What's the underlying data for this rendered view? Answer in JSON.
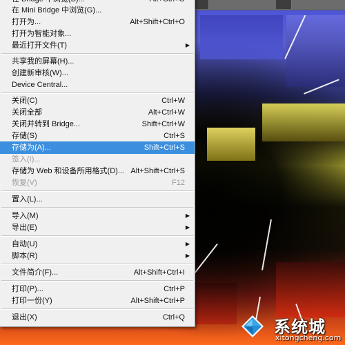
{
  "menu": {
    "items": [
      {
        "label": "在 Bridge 中浏览(B)...",
        "shortcut": "Alt+Ctrl+O",
        "arrow": "",
        "state": "normal"
      },
      {
        "label": "在 Mini Bridge 中浏览(G)...",
        "shortcut": "",
        "arrow": "",
        "state": "normal"
      },
      {
        "label": "打开为...",
        "shortcut": "Alt+Shift+Ctrl+O",
        "arrow": "",
        "state": "normal"
      },
      {
        "label": "打开为智能对象...",
        "shortcut": "",
        "arrow": "",
        "state": "normal"
      },
      {
        "label": "最近打开文件(T)",
        "shortcut": "",
        "arrow": "▶",
        "state": "normal"
      },
      {
        "label": "共享我的屏幕(H)...",
        "shortcut": "",
        "arrow": "",
        "state": "normal"
      },
      {
        "label": "创建新审核(W)...",
        "shortcut": "",
        "arrow": "",
        "state": "normal"
      },
      {
        "label": "Device Central...",
        "shortcut": "",
        "arrow": "",
        "state": "normal"
      },
      {
        "label": "关闭(C)",
        "shortcut": "Ctrl+W",
        "arrow": "",
        "state": "normal"
      },
      {
        "label": "关闭全部",
        "shortcut": "Alt+Ctrl+W",
        "arrow": "",
        "state": "normal"
      },
      {
        "label": "关闭并转到 Bridge...",
        "shortcut": "Shift+Ctrl+W",
        "arrow": "",
        "state": "normal"
      },
      {
        "label": "存储(S)",
        "shortcut": "Ctrl+S",
        "arrow": "",
        "state": "normal"
      },
      {
        "label": "存储为(A)...",
        "shortcut": "Shift+Ctrl+S",
        "arrow": "",
        "state": "highlighted"
      },
      {
        "label": "签入(I)...",
        "shortcut": "",
        "arrow": "",
        "state": "disabled"
      },
      {
        "label": "存储为 Web 和设备所用格式(D)...",
        "shortcut": "Alt+Shift+Ctrl+S",
        "arrow": "",
        "state": "normal"
      },
      {
        "label": "恢复(V)",
        "shortcut": "F12",
        "arrow": "",
        "state": "disabled"
      },
      {
        "label": "置入(L)...",
        "shortcut": "",
        "arrow": "",
        "state": "normal"
      },
      {
        "label": "导入(M)",
        "shortcut": "",
        "arrow": "▶",
        "state": "normal"
      },
      {
        "label": "导出(E)",
        "shortcut": "",
        "arrow": "▶",
        "state": "normal"
      },
      {
        "label": "自动(U)",
        "shortcut": "",
        "arrow": "▶",
        "state": "normal"
      },
      {
        "label": "脚本(R)",
        "shortcut": "",
        "arrow": "▶",
        "state": "normal"
      },
      {
        "label": "文件简介(F)...",
        "shortcut": "Alt+Shift+Ctrl+I",
        "arrow": "",
        "state": "normal"
      },
      {
        "label": "打印(P)...",
        "shortcut": "Ctrl+P",
        "arrow": "",
        "state": "normal"
      },
      {
        "label": "打印一份(Y)",
        "shortcut": "Alt+Shift+Ctrl+P",
        "arrow": "",
        "state": "normal"
      },
      {
        "label": "退出(X)",
        "shortcut": "Ctrl+Q",
        "arrow": "",
        "state": "normal"
      }
    ]
  },
  "watermark": {
    "title": "系统城",
    "url": "xitongcheng.com"
  },
  "colors": {
    "menu_bg": "#f0f0f0",
    "highlight": "#3b8fde",
    "disabled": "#9a9a9a"
  }
}
